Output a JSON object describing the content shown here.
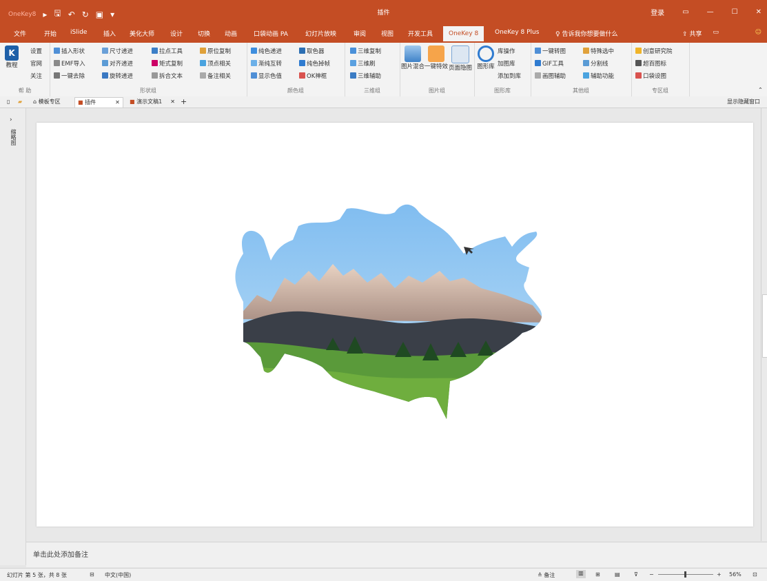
{
  "app": {
    "brand": "OneKey8",
    "document_title": "插件",
    "login": "登录",
    "accent": "#c44d24"
  },
  "menu_tabs": [
    {
      "label": "文件"
    },
    {
      "label": "开始"
    },
    {
      "label": "iSlide"
    },
    {
      "label": "插入"
    },
    {
      "label": "美化大师"
    },
    {
      "label": "设计"
    },
    {
      "label": "切换"
    },
    {
      "label": "动画"
    },
    {
      "label": "口袋动画 PA"
    },
    {
      "label": "幻灯片放映"
    },
    {
      "label": "审阅"
    },
    {
      "label": "视图"
    },
    {
      "label": "开发工具"
    },
    {
      "label": "OneKey 8"
    },
    {
      "label": "OneKey 8 Plus"
    }
  ],
  "tell_me": "告诉我你想要做什么",
  "share": "共享",
  "ribbon": {
    "help": {
      "tutorial": "教程",
      "settings": "设置",
      "website": "官网",
      "about": "关注",
      "label": "帮 助"
    },
    "shape": {
      "items": [
        "插入形状",
        "尺寸递进",
        "拉点工具",
        "原位复制",
        "EMF导入",
        "对齐递进",
        "矩式复制",
        "顶点相关",
        "一键去除",
        "旋转递进",
        "拆合文本",
        "备注相关"
      ],
      "label": "形状组"
    },
    "color": {
      "items": [
        "纯色递进",
        "取色器",
        "渐纯互转",
        "纯色掉帧",
        "显示色值",
        "OK神框"
      ],
      "label": "颜色组"
    },
    "threed": {
      "items": [
        "三维复制",
        "三维刷",
        "三维辅助"
      ],
      "label": "三维组"
    },
    "picture": {
      "items": [
        "图片混合",
        "一键特效",
        "页面隐图"
      ],
      "label": "图片组"
    },
    "library": {
      "items": [
        "图形库",
        "库操作",
        "加图库",
        "添加到库"
      ],
      "label": "图形库"
    },
    "other": {
      "items": [
        "一键转图",
        "特殊选中",
        "GIF工具",
        "分割线",
        "画图辅助",
        "辅助功能"
      ],
      "label": "其他组"
    },
    "special": {
      "items": [
        "创意研究院",
        "超百图标",
        "口袋设图"
      ],
      "label": "专区组"
    }
  },
  "doc_tabs": [
    "模板专区",
    "插件",
    "演示文稿1"
  ],
  "restore_btn": "显示隐藏窗口",
  "left_panel": "缩略图",
  "notes": {
    "placeholder": "单击此处添加备注"
  },
  "status": {
    "slide_info": "幻灯片 第 5 张，共 8 张",
    "language": "中文(中国)",
    "notes_btn": "备注",
    "zoom": "56%"
  }
}
